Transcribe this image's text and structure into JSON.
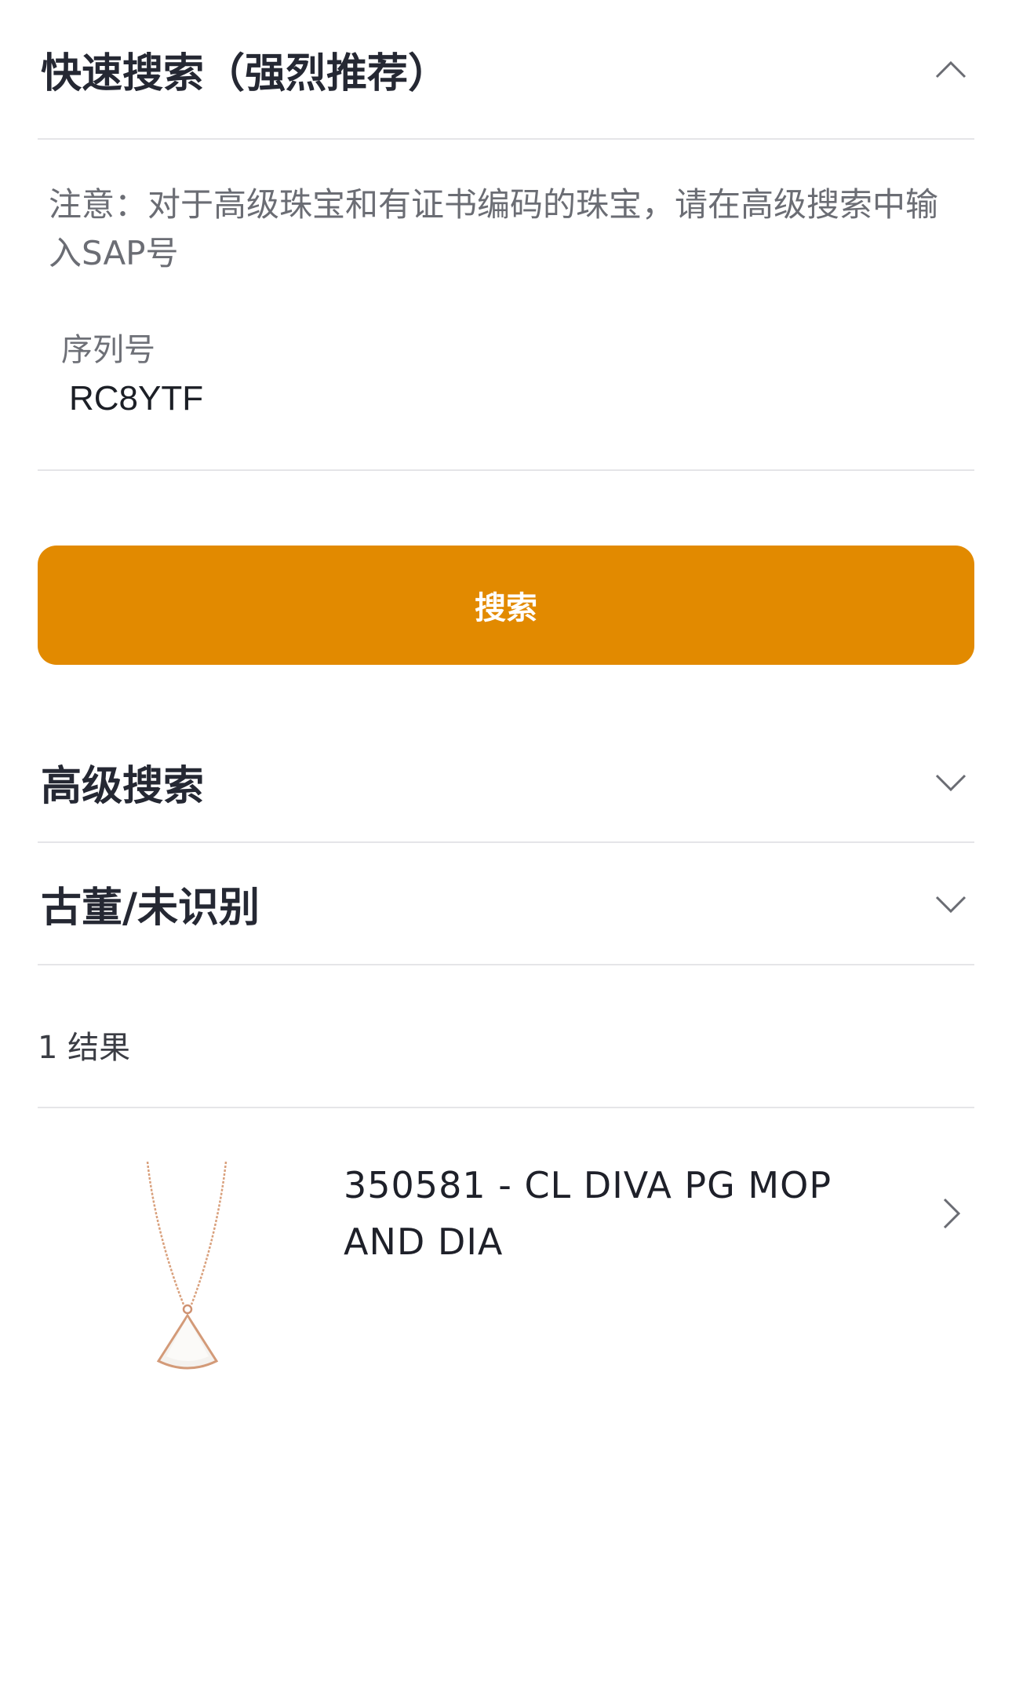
{
  "quick_search": {
    "title": "快速搜索（强烈推荐）",
    "expanded": true,
    "note": "注意：对于高级珠宝和有证书编码的珠宝，请在高级搜索中输入SAP号",
    "serial_label": "序列号",
    "serial_value": "RC8YTF",
    "search_button_label": "搜索"
  },
  "advanced_search": {
    "title": "高级搜索",
    "expanded": false
  },
  "antique": {
    "title": "古董/未识别",
    "expanded": false
  },
  "results": {
    "count_label": "1 结果",
    "items": [
      {
        "title": "350581 - CL DIVA PG MOP AND DIA",
        "thumbnail_icon": "necklace-pendant-image"
      }
    ]
  },
  "colors": {
    "accent": "#e28a00",
    "divider": "#e5e5e8",
    "text_primary": "#252833",
    "text_muted": "#6b6d74"
  }
}
